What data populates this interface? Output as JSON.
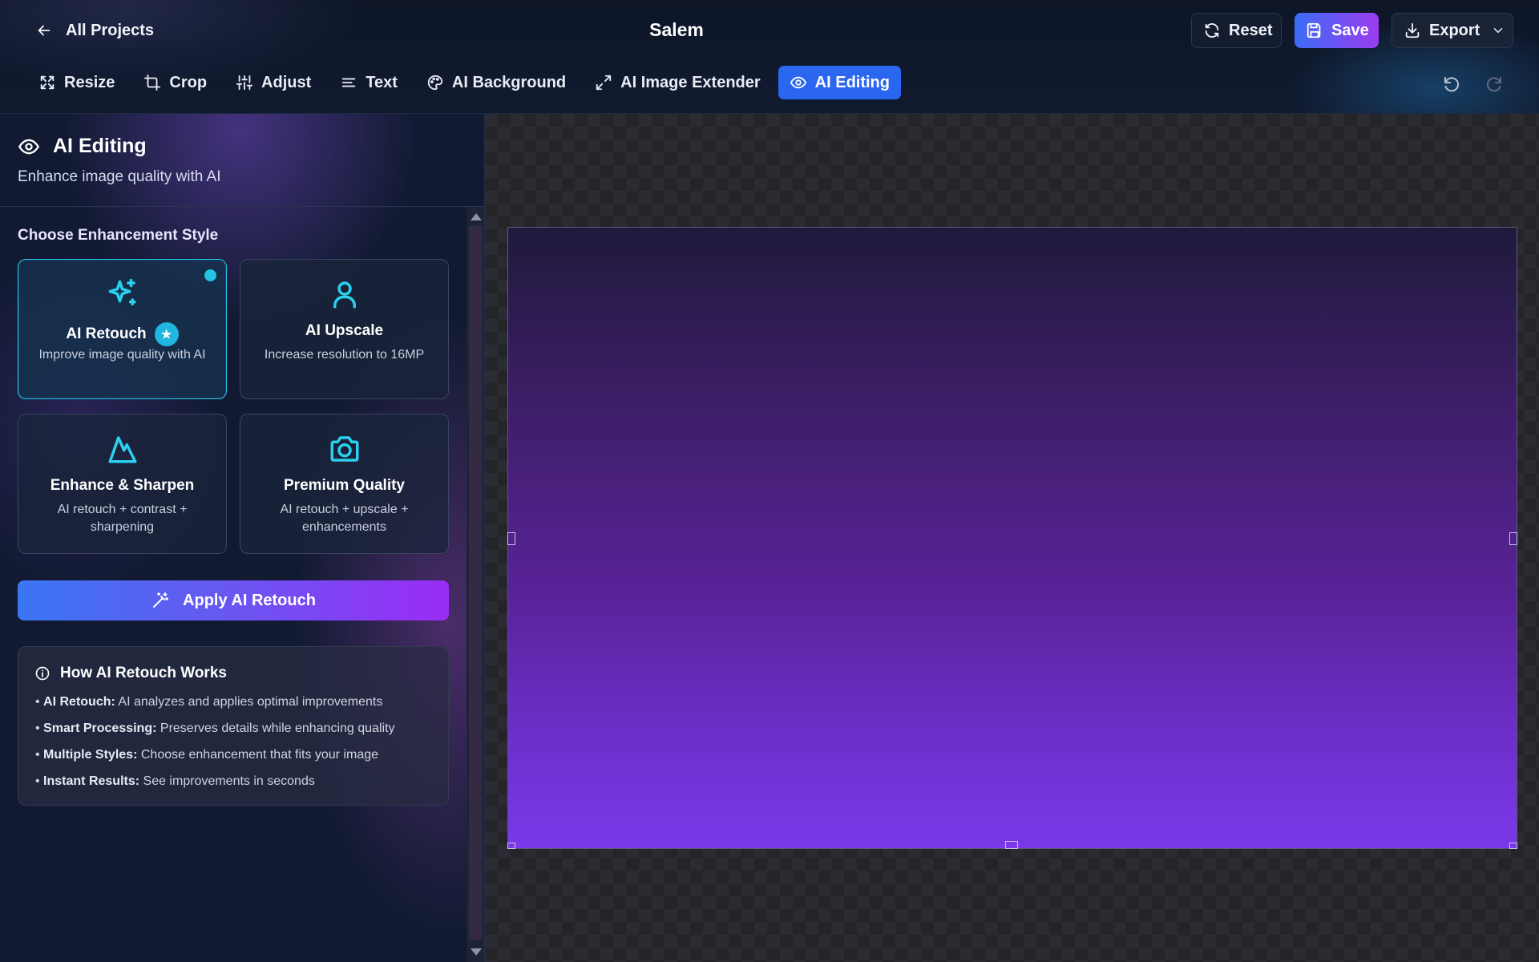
{
  "header": {
    "back_label": "All Projects",
    "project_title": "Salem",
    "reset_label": "Reset",
    "save_label": "Save",
    "export_label": "Export"
  },
  "toolbar": {
    "tools": [
      {
        "label": "Resize",
        "icon": "resize-icon"
      },
      {
        "label": "Crop",
        "icon": "crop-icon"
      },
      {
        "label": "Adjust",
        "icon": "sliders-icon"
      },
      {
        "label": "Text",
        "icon": "text-icon"
      },
      {
        "label": "AI Background",
        "icon": "palette-icon"
      },
      {
        "label": "AI Image Extender",
        "icon": "expand-icon"
      },
      {
        "label": "AI Editing",
        "icon": "eye-icon",
        "active": true
      }
    ],
    "undo_icon": "undo-icon",
    "redo_icon": "redo-icon"
  },
  "panel": {
    "title": "AI Editing",
    "subtitle": "Enhance image quality with AI",
    "section_label": "Choose Enhancement Style",
    "styles": [
      {
        "title": "AI Retouch",
        "desc": "Improve image quality with AI",
        "icon": "sparkles-icon",
        "selected": true,
        "badge": "★"
      },
      {
        "title": "AI Upscale",
        "desc": "Increase resolution to 16MP",
        "icon": "user-icon",
        "selected": false
      },
      {
        "title": "Enhance & Sharpen",
        "desc": "AI retouch + contrast + sharpening",
        "icon": "mountain-icon",
        "selected": false
      },
      {
        "title": "Premium Quality",
        "desc": "AI retouch + upscale + enhancements",
        "icon": "camera-icon",
        "selected": false
      }
    ],
    "apply_label": "Apply AI Retouch",
    "info": {
      "title": "How AI Retouch Works",
      "items": [
        {
          "bold": "AI Retouch:",
          "text": "AI analyzes and applies optimal improvements"
        },
        {
          "bold": "Smart Processing:",
          "text": "Preserves details while enhancing quality"
        },
        {
          "bold": "Multiple Styles:",
          "text": "Choose enhancement that fits your image"
        },
        {
          "bold": "Instant Results:",
          "text": "See improvements in seconds"
        }
      ]
    }
  },
  "colors": {
    "accent": "#2a66f0",
    "cyan": "#22c3e6",
    "save_gradient_start": "#3b6cf6",
    "save_gradient_end": "#9b3cf0",
    "image_top": "#1f1a3c",
    "image_bottom": "#7a39ea"
  }
}
